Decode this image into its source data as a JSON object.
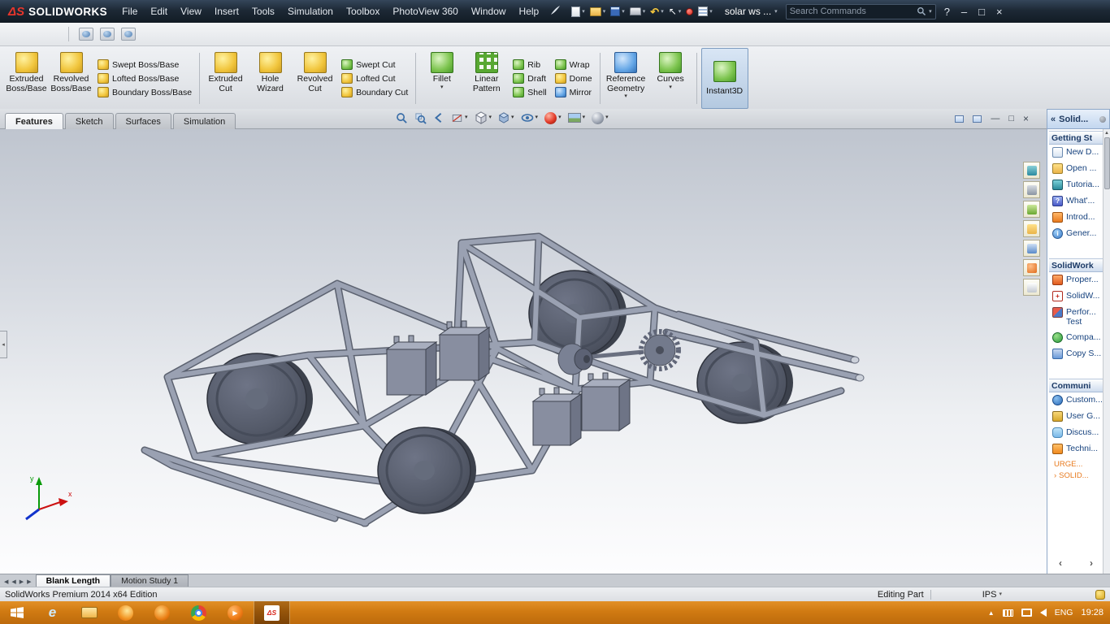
{
  "titlebar": {
    "logo_mark": "ΔS",
    "brand": "SOLIDWORKS",
    "menus": [
      "File",
      "Edit",
      "View",
      "Insert",
      "Tools",
      "Simulation",
      "Toolbox",
      "PhotoView 360",
      "Window",
      "Help"
    ],
    "document_name": "solar ws ...",
    "search_placeholder": "Search Commands",
    "help_label": "?"
  },
  "ribbon": {
    "large": {
      "extruded_boss": [
        "Extruded",
        "Boss/Base"
      ],
      "revolved_boss": [
        "Revolved",
        "Boss/Base"
      ],
      "extruded_cut": [
        "Extruded",
        "Cut"
      ],
      "hole_wizard": [
        "Hole",
        "Wizard"
      ],
      "revolved_cut": [
        "Revolved",
        "Cut"
      ],
      "fillet": [
        "Fillet"
      ],
      "linear_pattern": [
        "Linear",
        "Pattern"
      ],
      "reference_geometry": [
        "Reference",
        "Geometry"
      ],
      "curves": [
        "Curves"
      ],
      "instant3d": [
        "Instant3D"
      ]
    },
    "stacks": {
      "boss": [
        "Swept Boss/Base",
        "Lofted Boss/Base",
        "Boundary Boss/Base"
      ],
      "cut": [
        "Swept Cut",
        "Lofted Cut",
        "Boundary Cut"
      ],
      "features1": [
        "Rib",
        "Draft",
        "Shell"
      ],
      "features2": [
        "Wrap",
        "Dome",
        "Mirror"
      ]
    },
    "tabs": [
      "Features",
      "Sketch",
      "Surfaces",
      "Simulation"
    ]
  },
  "taskpane": {
    "title": "Solid...",
    "sections": [
      {
        "header": "Getting St",
        "items": [
          "New D...",
          "Open ...",
          "Tutoria...",
          "What'...",
          "Introd...",
          "Gener..."
        ]
      },
      {
        "header": "SolidWork",
        "items": [
          "Proper...",
          "SolidW...",
          "Perfor... Test",
          "Compa...",
          "Copy S..."
        ]
      },
      {
        "header": "Communi",
        "items": [
          "Custom...",
          "User G...",
          "Discus...",
          "Techni..."
        ]
      }
    ],
    "alert_links": [
      "URGE...",
      "SOLID..."
    ]
  },
  "bottom": {
    "model_tab": "Blank Length",
    "motion_tab": "Motion Study 1"
  },
  "statusbar": {
    "edition": "SolidWorks Premium 2014 x64 Edition",
    "mode": "Editing Part",
    "units": "IPS"
  },
  "taskbar": {
    "lang": "ENG",
    "time": "19:28"
  },
  "triad": {
    "x": "x",
    "y": "y"
  }
}
